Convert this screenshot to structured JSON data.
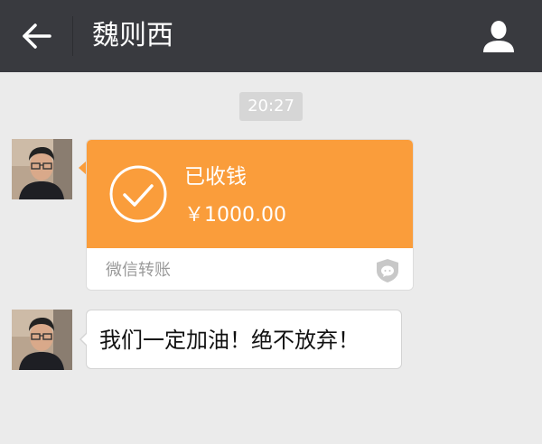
{
  "header": {
    "title": "魏则西",
    "back_icon": "arrow-left-icon",
    "profile_icon": "person-icon",
    "background": "#393a3f"
  },
  "timestamp": "20:27",
  "messages": [
    {
      "type": "transfer",
      "sender": "contact",
      "status": "已收钱",
      "amount": "￥1000.00",
      "label": "微信转账",
      "status_icon": "check-circle-icon",
      "brand_icon": "wechat-shield-icon",
      "accent": "#fa9d3b"
    },
    {
      "type": "text",
      "sender": "contact",
      "text": "我们一定加油！绝不放弃！"
    }
  ],
  "colors": {
    "chat_background": "#ebebeb",
    "bubble": "#ffffff",
    "transfer_orange": "#fa9d3b"
  }
}
